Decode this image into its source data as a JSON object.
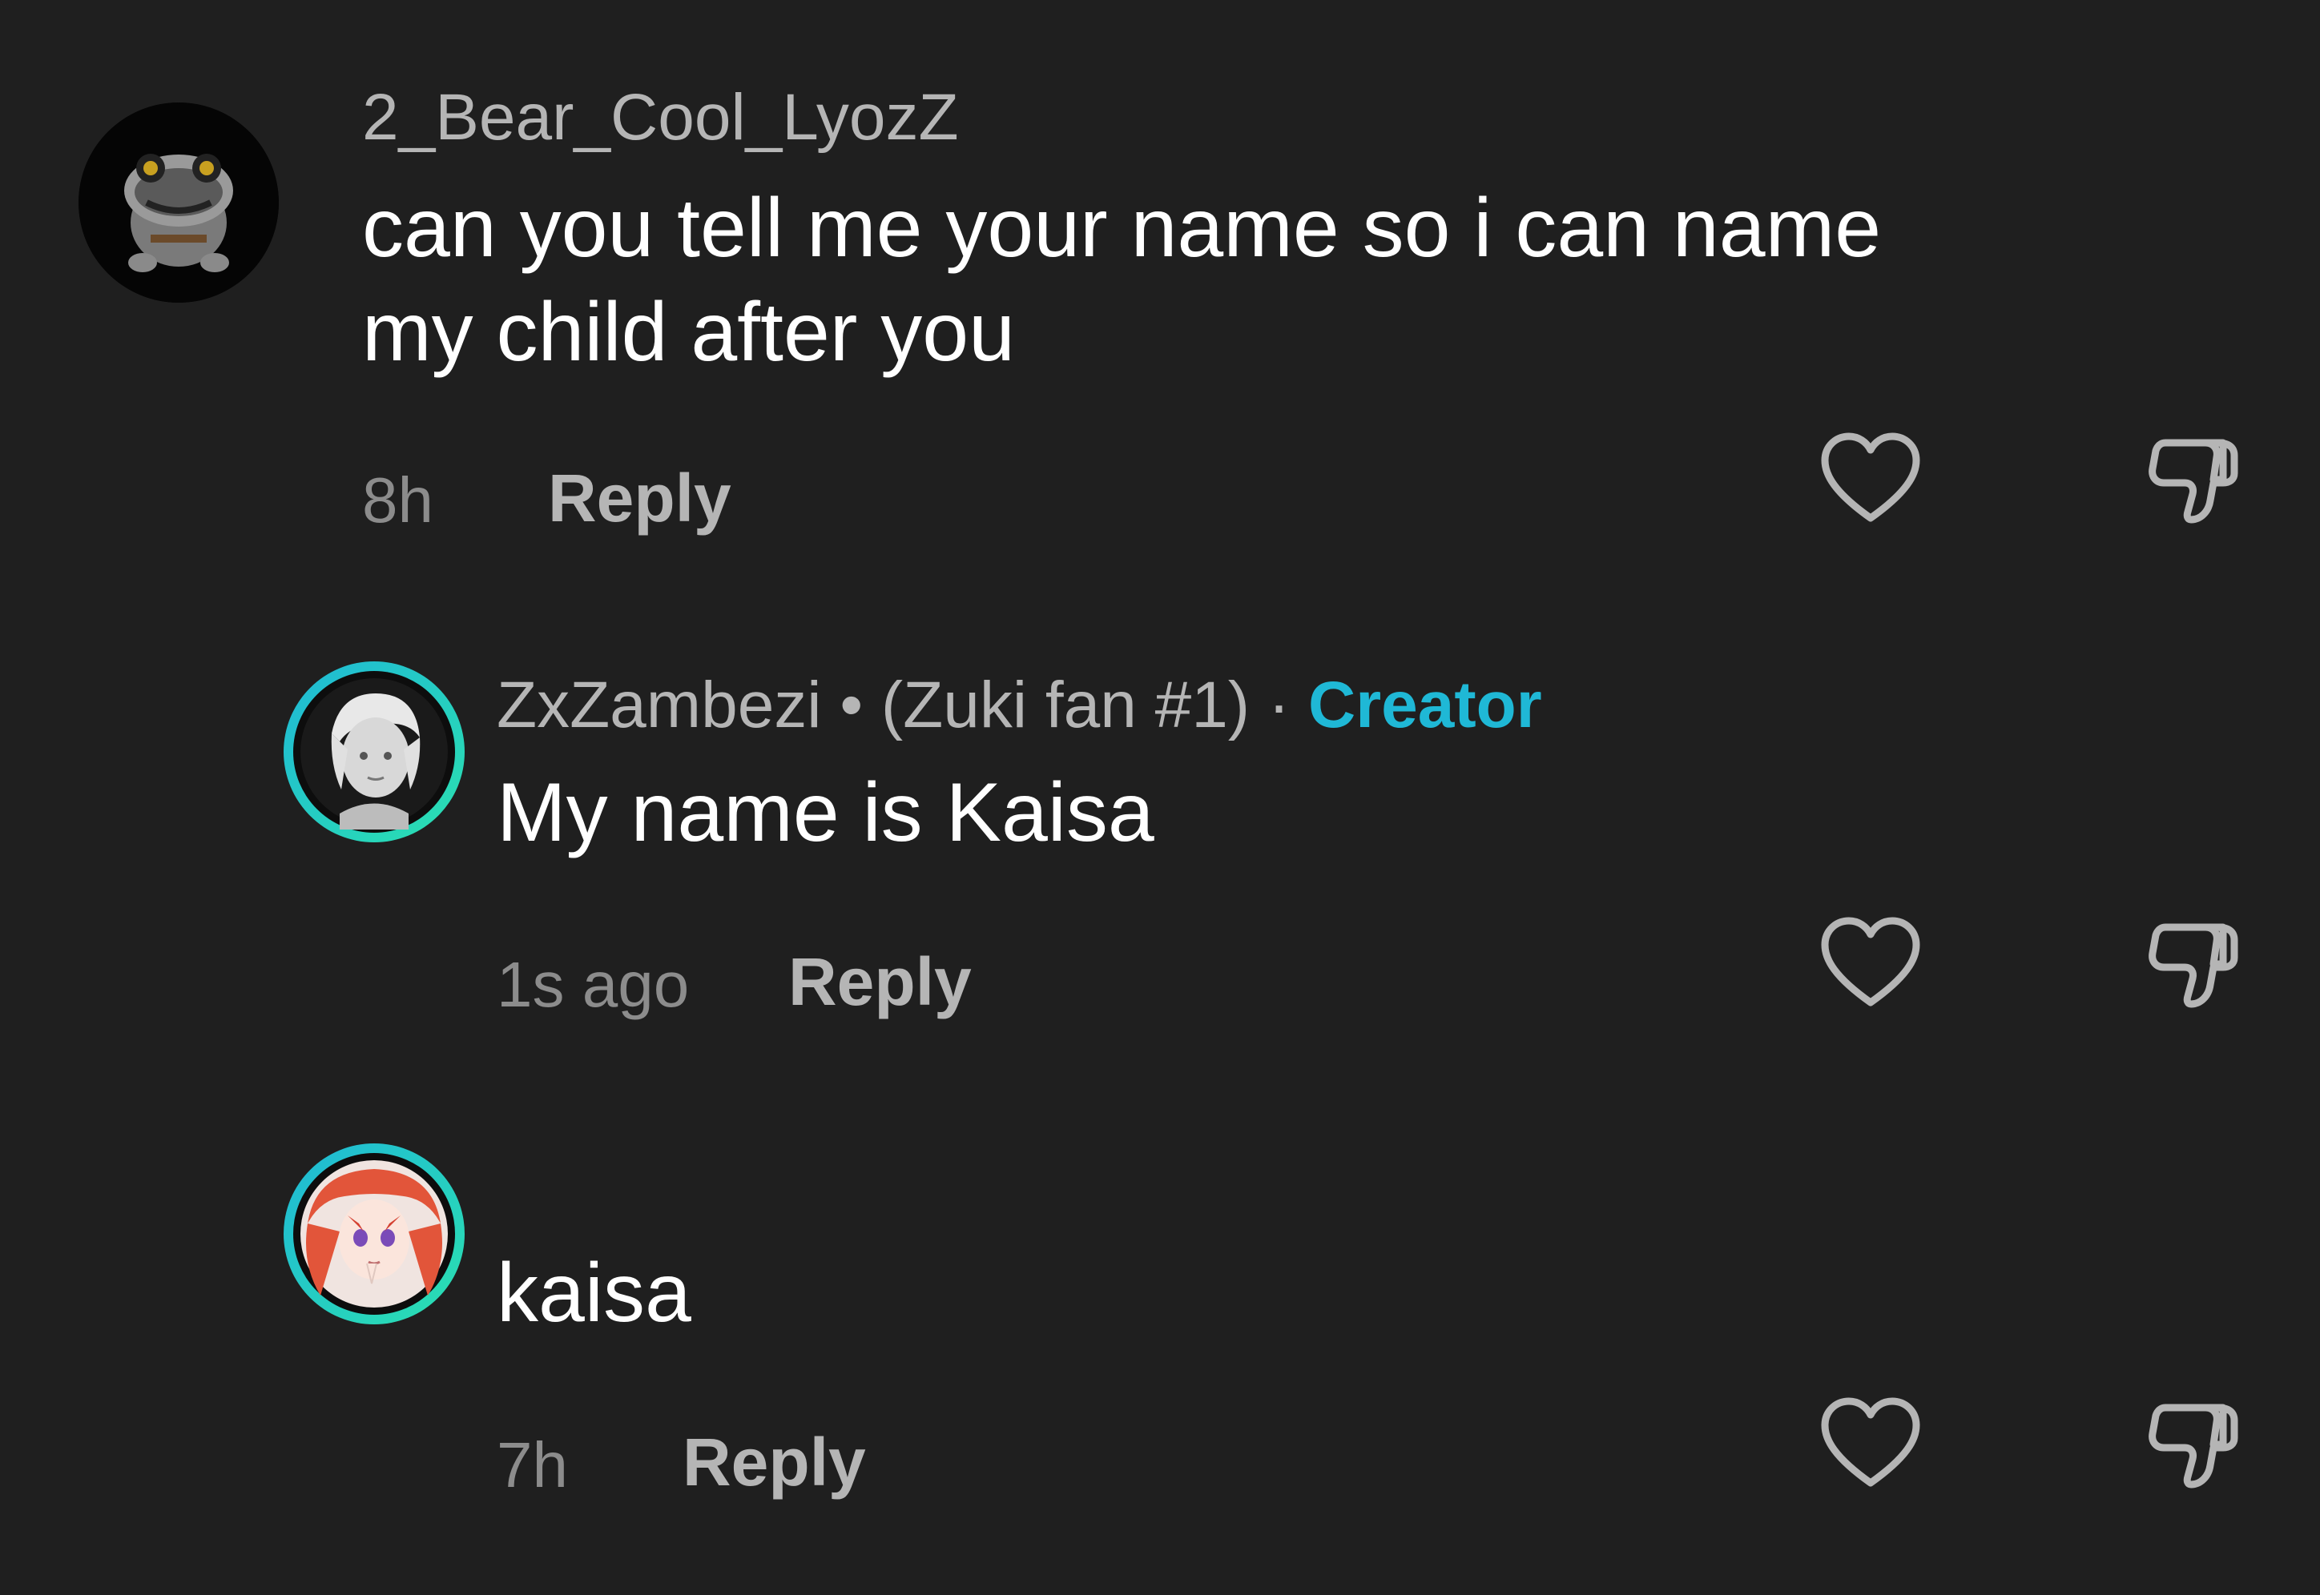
{
  "comments": [
    {
      "username": "2_Bear_Cool_LyozZ",
      "text_line1": "can you tell me your name so i can name",
      "text_line2": "my child after you",
      "time": "8h",
      "reply_label": "Reply"
    },
    {
      "username": "ZxZambezi",
      "separator": "•",
      "tagline": "(Zuki fan #1)",
      "dot": "·",
      "creator_label": "Creator",
      "text": "My name is Kaisa",
      "time": "1s ago",
      "reply_label": "Reply"
    },
    {
      "text": "kaisa",
      "time": "7h",
      "reply_label": "Reply"
    }
  ],
  "icons": {
    "like": "heart-icon",
    "dislike": "thumbs-down-icon"
  },
  "colors": {
    "background": "#1f1f1f",
    "creator_accent": "#1fb8d6",
    "avatar_ring_start": "#1fb8d6",
    "avatar_ring_end": "#2be0b0"
  }
}
